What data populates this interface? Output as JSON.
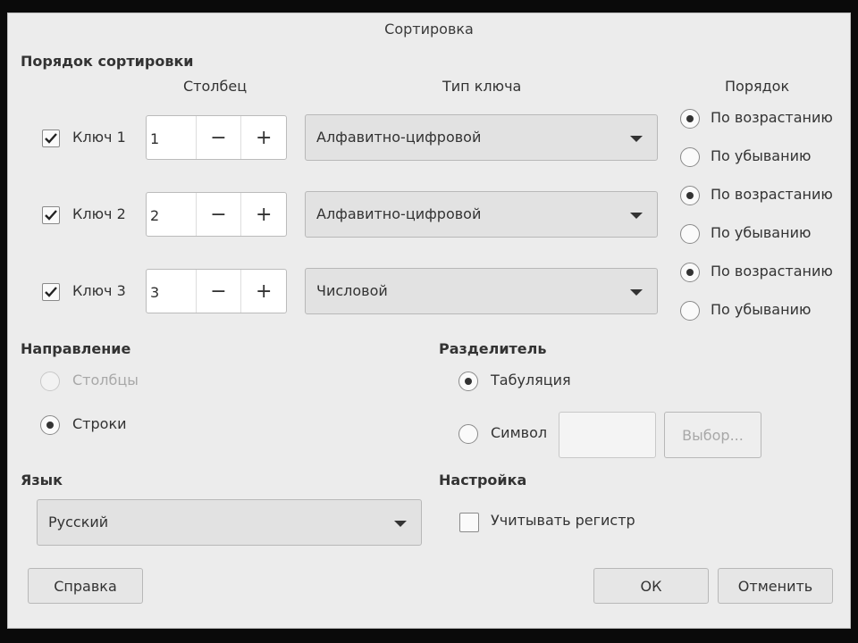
{
  "dialog": {
    "title": "Сортировка"
  },
  "sort_order": {
    "section": "Порядок сортировки",
    "col_header": "Столбец",
    "type_header": "Тип ключа",
    "order_header": "Порядок",
    "keys": [
      {
        "label": "Ключ 1",
        "checked": true,
        "column": "1",
        "type": "Алфавитно-цифровой",
        "asc": "По возрастанию",
        "desc": "По убыванию",
        "order": "asc"
      },
      {
        "label": "Ключ 2",
        "checked": true,
        "column": "2",
        "type": "Алфавитно-цифровой",
        "asc": "По возрастанию",
        "desc": "По убыванию",
        "order": "asc"
      },
      {
        "label": "Ключ 3",
        "checked": true,
        "column": "3",
        "type": "Числовой",
        "asc": "По возрастанию",
        "desc": "По убыванию",
        "order": "asc"
      }
    ],
    "minus": "−",
    "plus": "+"
  },
  "direction": {
    "section": "Направление",
    "columns": "Столбцы",
    "rows": "Строки",
    "selected": "rows"
  },
  "separator": {
    "section": "Разделитель",
    "tab": "Табуляция",
    "symbol": "Символ",
    "symbol_value": "",
    "choose": "Выбор...",
    "selected": "tab"
  },
  "language": {
    "section": "Язык",
    "value": "Русский"
  },
  "options": {
    "section": "Настройка",
    "case": "Учитывать регистр",
    "case_checked": false
  },
  "buttons": {
    "help": "Справка",
    "ok": "ОК",
    "cancel": "Отменить"
  }
}
